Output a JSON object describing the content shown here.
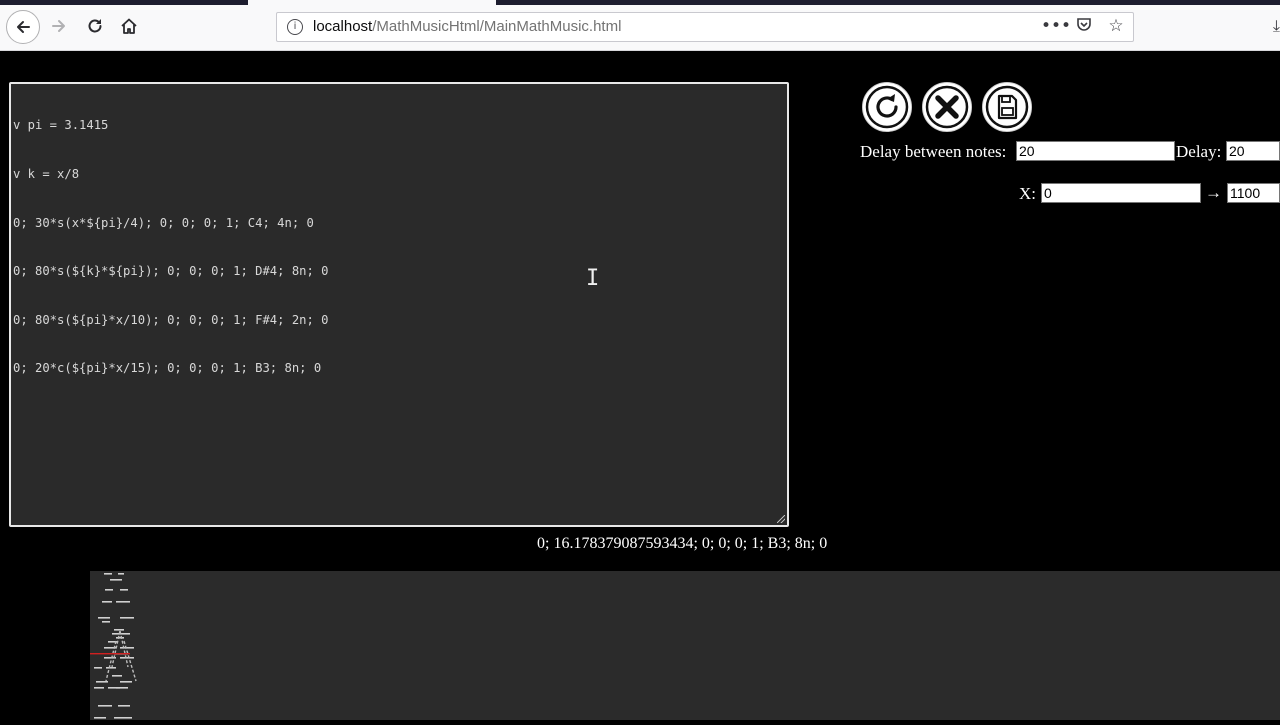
{
  "browser": {
    "url_host": "localhost",
    "url_path": "/MathMusicHtml/MainMathMusic.html",
    "icons": {
      "back": "back-arrow-icon",
      "forward": "forward-arrow-icon",
      "reload": "reload-icon",
      "home": "home-icon",
      "info": "info-icon",
      "more": "more-dots-icon",
      "pocket": "pocket-icon",
      "bookmark": "bookmark-star-icon",
      "download": "download-icon"
    }
  },
  "editor": {
    "lines": [
      "v pi = 3.1415",
      "v k = x/8",
      "0; 30*s(x*${pi}/4); 0; 0; 0; 1; C4; 4n; 0",
      "0; 80*s(${k}*${pi}); 0; 0; 0; 1; D#4; 8n; 0",
      "0; 80*s(${pi}*x/10); 0; 0; 0; 1; F#4; 2n; 0",
      "0; 20*c(${pi}*x/15); 0; 0; 0; 1; B3; 8n; 0"
    ]
  },
  "controls": {
    "buttons": {
      "reset": "reset-icon",
      "stop": "close-icon",
      "save": "save-icon"
    },
    "delay_between_notes_label": "Delay between notes:",
    "delay_between_notes_value": "20",
    "delay_label": "Delay:",
    "delay_value": "20",
    "x_label": "X:",
    "x_from": "0",
    "arrow": "→",
    "x_to": "1100"
  },
  "output_line": "0; 16.178379087593434; 0; 0; 0; 1; B3; 8n; 0",
  "colors": {
    "background": "#000000",
    "editor_bg": "#2a2a2a",
    "editor_text": "#d8d8d8",
    "viz_bg": "#2b2b2b",
    "viz_marker": "#d02020"
  }
}
